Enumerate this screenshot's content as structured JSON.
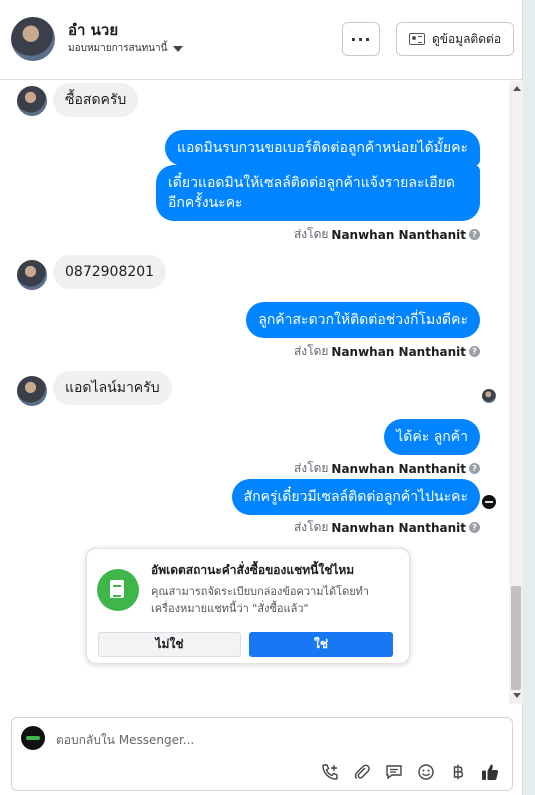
{
  "header": {
    "name": "อำ นวย",
    "assign_label": "มอบหมายการสนทนานี้",
    "more_label": "···",
    "contact_label": "ดูข้อมูลติดต่อ"
  },
  "messages": {
    "in1": "ซื้อสดครับ",
    "out1": "แอดมินรบกวนขอเบอร์ติดต่อลูกค้าหน่อยได้มั้ยคะ",
    "out2": "เดี๋ยวแอดมินให้เซลล์ติดต่อลูกค้าแจ้งรายละเอียดอีกครั้งนะคะ",
    "in2": "0872908201",
    "out3": "ลูกค้าสะดวกให้ติดต่อช่วงกี่โมงดีคะ",
    "in3": "แอดไลน์มาครับ",
    "out4": "ได้ค่ะ ลูกค้า",
    "out5": "สักครู่เดี๋ยวมีเซลล์ติดต่อลูกค้าไปนะคะ"
  },
  "sent_by": {
    "prefix": "ส่งโดย",
    "agent": "Nanwhan Nanthanit"
  },
  "order_card": {
    "title": "อัพเดตสถานะคำสั่งซื้อของแชทนี้ใช่ไหม",
    "description": "คุณสามารถจัดระเบียบกล่องข้อความได้โดยทำเครื่องหมายแชทนี้ว่า \"สั่งซื้อแล้ว\"",
    "no_label": "ไม่ใช่",
    "yes_label": "ใช่"
  },
  "composer": {
    "placeholder": "ตอบกลับใน Messenger..."
  },
  "colors": {
    "outgoing_bubble": "#0084ff",
    "primary_button": "#1877f2",
    "order_icon": "#3fb649"
  },
  "icons": [
    "call-add-icon",
    "attachment-icon",
    "saved-reply-icon",
    "emoji-icon",
    "baht-icon",
    "thumbs-up-icon"
  ]
}
